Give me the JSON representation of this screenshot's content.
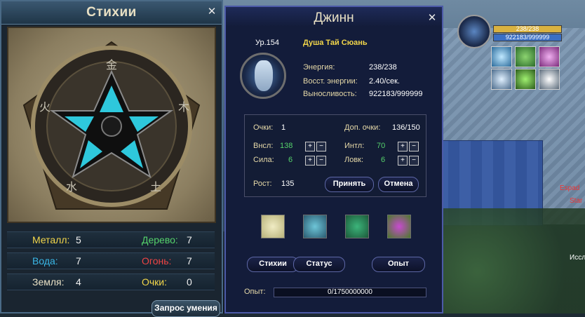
{
  "stihii": {
    "title": "Стихии",
    "close_glyph": "✕",
    "stats": [
      {
        "label": "Металл:",
        "value": "5",
        "color": "#f2d64a"
      },
      {
        "label": "Дерево:",
        "value": "7",
        "color": "#55d26b"
      },
      {
        "label": "Вода:",
        "value": "7",
        "color": "#3ab7e6"
      },
      {
        "label": "Огонь:",
        "value": "7",
        "color": "#ee4444"
      },
      {
        "label": "Земля:",
        "value": "4",
        "color": "#e8e0c4"
      },
      {
        "label": "Очки:",
        "value": "0",
        "color": "#f2d64a"
      }
    ],
    "request_button": "Запрос умения"
  },
  "djinn": {
    "title": "Джинн",
    "close_glyph": "✕",
    "level": "Ур.154",
    "soul_name": "Душа Тай Сюань",
    "info": [
      {
        "label": "Энергия:",
        "value": "238/238"
      },
      {
        "label": "Восст. энергии:",
        "value": "2.40/сек."
      },
      {
        "label": "Выносливость:",
        "value": "922183/999999"
      }
    ],
    "points": {
      "label": "Очки:",
      "value": "1",
      "extra_label": "Доп. очки:",
      "extra_value": "136/150"
    },
    "attributes": [
      {
        "label": "Внсл:",
        "value": "138",
        "green": true
      },
      {
        "label": "Интл:",
        "value": "70",
        "green": true
      },
      {
        "label": "Сила:",
        "value": "6",
        "green": true
      },
      {
        "label": "Ловк:",
        "value": "6",
        "green": true
      }
    ],
    "growth_label": "Рост:",
    "growth_value": "135",
    "accept_button": "Принять",
    "cancel_button": "Отмена",
    "tabs": [
      "Стихии",
      "Статус",
      "Опыт"
    ],
    "xp_label": "Опыт:",
    "xp_value": "0/1750000000",
    "xp_fraction": 0
  },
  "hud": {
    "hp_text": "238/238",
    "mp_text": "922183/999999"
  },
  "world": {
    "name1": "Espad",
    "name2": "Star",
    "name3": "Иссл"
  }
}
